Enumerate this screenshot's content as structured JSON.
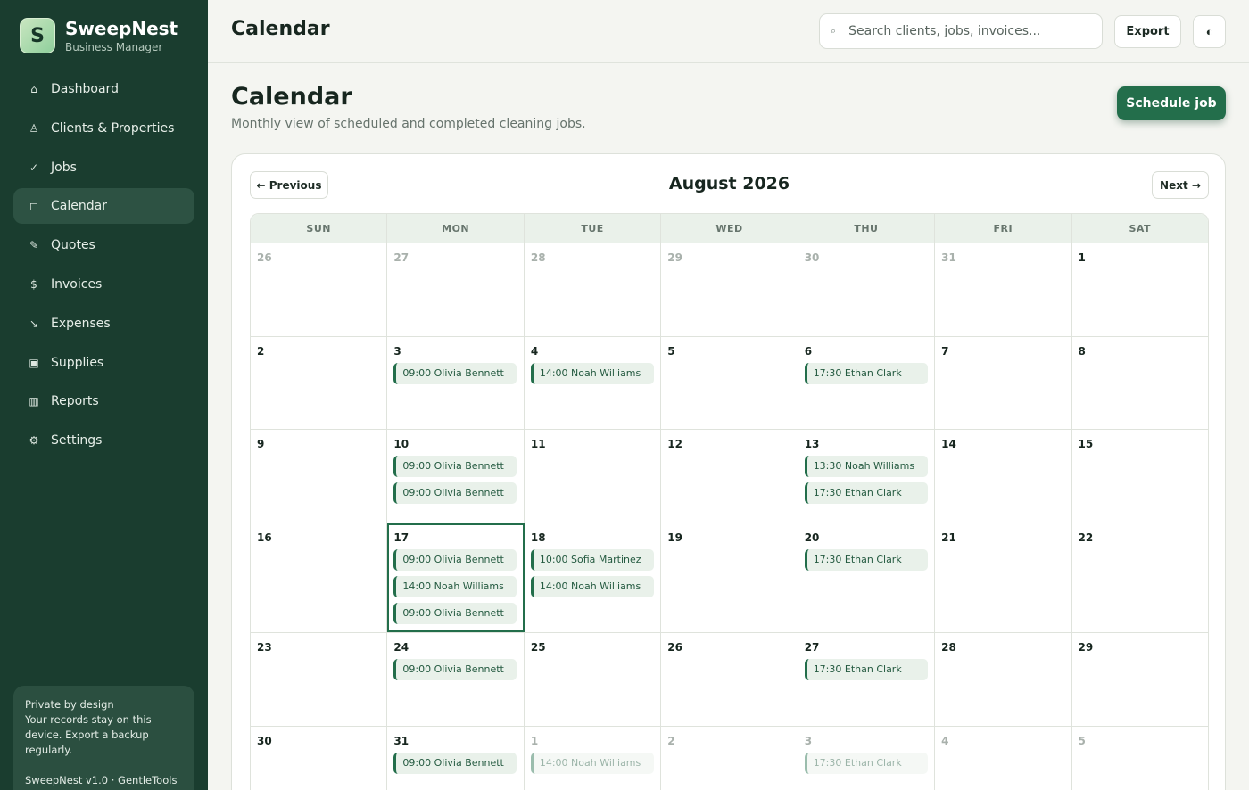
{
  "app": {
    "name": "SweepNest",
    "subtitle": "Business Manager",
    "logo_letter": "S"
  },
  "sidebar": {
    "items": [
      {
        "label": "Dashboard",
        "icon": "⌂",
        "icon_name": "home-icon",
        "active": false
      },
      {
        "label": "Clients & Properties",
        "icon": "♙",
        "icon_name": "person-icon",
        "active": false
      },
      {
        "label": "Jobs",
        "icon": "✓",
        "icon_name": "check-icon",
        "active": false
      },
      {
        "label": "Calendar",
        "icon": "◻",
        "icon_name": "calendar-icon",
        "active": true
      },
      {
        "label": "Quotes",
        "icon": "✎",
        "icon_name": "pencil-icon",
        "active": false
      },
      {
        "label": "Invoices",
        "icon": "$",
        "icon_name": "dollar-icon",
        "active": false
      },
      {
        "label": "Expenses",
        "icon": "↘",
        "icon_name": "arrow-down-right-icon",
        "active": false
      },
      {
        "label": "Supplies",
        "icon": "▣",
        "icon_name": "box-icon",
        "active": false
      },
      {
        "label": "Reports",
        "icon": "▥",
        "icon_name": "chart-icon",
        "active": false
      },
      {
        "label": "Settings",
        "icon": "⚙",
        "icon_name": "gear-icon",
        "active": false
      }
    ],
    "privacy": {
      "title": "Private by design",
      "body": "Your records stay on this device. Export a backup regularly.",
      "version": "SweepNest v1.0 · GentleTools"
    }
  },
  "topbar": {
    "title": "Calendar",
    "search_placeholder": "Search clients, jobs, invoices...",
    "search_icon": "⌕",
    "export_label": "Export",
    "theme_icon": "◐"
  },
  "page": {
    "title": "Calendar",
    "subtitle": "Monthly view of scheduled and completed cleaning jobs.",
    "schedule_label": "Schedule job"
  },
  "calendar": {
    "month_label": "August 2026",
    "prev_label": "← Previous",
    "next_label": "Next →",
    "weekdays": [
      "SUN",
      "MON",
      "TUE",
      "WED",
      "THU",
      "FRI",
      "SAT"
    ],
    "weeks": [
      [
        {
          "day": "26",
          "muted": true,
          "events": []
        },
        {
          "day": "27",
          "muted": true,
          "events": []
        },
        {
          "day": "28",
          "muted": true,
          "events": []
        },
        {
          "day": "29",
          "muted": true,
          "events": []
        },
        {
          "day": "30",
          "muted": true,
          "events": []
        },
        {
          "day": "31",
          "muted": true,
          "events": []
        },
        {
          "day": "1",
          "events": []
        }
      ],
      [
        {
          "day": "2",
          "events": []
        },
        {
          "day": "3",
          "events": [
            "09:00 Olivia Bennett"
          ]
        },
        {
          "day": "4",
          "events": [
            "14:00 Noah Williams"
          ]
        },
        {
          "day": "5",
          "events": []
        },
        {
          "day": "6",
          "events": [
            "17:30 Ethan Clark"
          ]
        },
        {
          "day": "7",
          "events": []
        },
        {
          "day": "8",
          "events": []
        }
      ],
      [
        {
          "day": "9",
          "events": []
        },
        {
          "day": "10",
          "events": [
            "09:00 Olivia Bennett",
            "09:00 Olivia Bennett"
          ]
        },
        {
          "day": "11",
          "events": []
        },
        {
          "day": "12",
          "events": []
        },
        {
          "day": "13",
          "events": [
            "13:30 Noah Williams",
            "17:30 Ethan Clark"
          ]
        },
        {
          "day": "14",
          "events": []
        },
        {
          "day": "15",
          "events": []
        }
      ],
      [
        {
          "day": "16",
          "events": []
        },
        {
          "day": "17",
          "today": true,
          "events": [
            "09:00 Olivia Bennett",
            "14:00 Noah Williams",
            "09:00 Olivia Bennett"
          ]
        },
        {
          "day": "18",
          "events": [
            "10:00 Sofia Martinez",
            "14:00 Noah Williams"
          ]
        },
        {
          "day": "19",
          "events": []
        },
        {
          "day": "20",
          "events": [
            "17:30 Ethan Clark"
          ]
        },
        {
          "day": "21",
          "events": []
        },
        {
          "day": "22",
          "events": []
        }
      ],
      [
        {
          "day": "23",
          "events": []
        },
        {
          "day": "24",
          "events": [
            "09:00 Olivia Bennett"
          ]
        },
        {
          "day": "25",
          "events": []
        },
        {
          "day": "26",
          "events": []
        },
        {
          "day": "27",
          "events": [
            "17:30 Ethan Clark"
          ]
        },
        {
          "day": "28",
          "events": []
        },
        {
          "day": "29",
          "events": []
        }
      ],
      [
        {
          "day": "30",
          "events": []
        },
        {
          "day": "31",
          "events": [
            "09:00 Olivia Bennett"
          ]
        },
        {
          "day": "1",
          "muted": true,
          "events": [
            "14:00 Noah Williams"
          ]
        },
        {
          "day": "2",
          "muted": true,
          "events": []
        },
        {
          "day": "3",
          "muted": true,
          "events": [
            "17:30 Ethan Clark"
          ]
        },
        {
          "day": "4",
          "muted": true,
          "events": []
        },
        {
          "day": "5",
          "muted": true,
          "events": []
        }
      ]
    ]
  },
  "colors": {
    "sidebar_bg": "#1a3d2f",
    "accent": "#236e4b",
    "event_bg": "#e9f1ea"
  }
}
